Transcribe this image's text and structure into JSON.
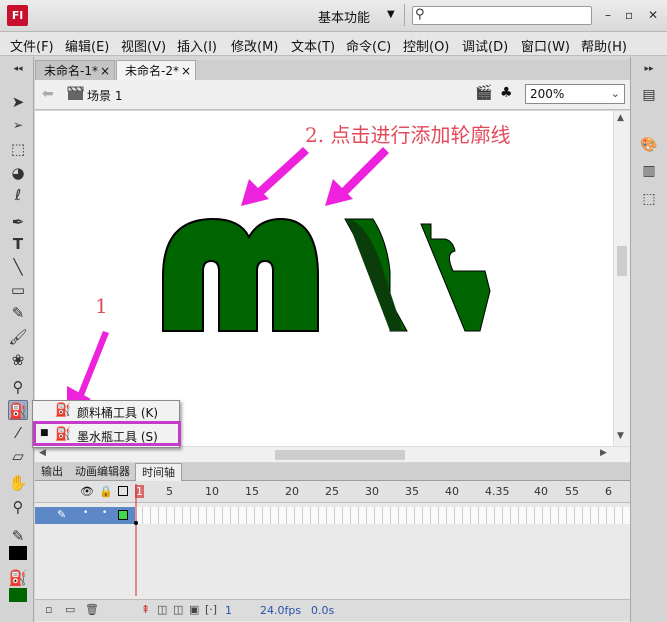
{
  "app": {
    "logo": "Fl",
    "workspace": "基本功能",
    "search_placeholder": ""
  },
  "window_controls": [
    "–",
    "▫",
    "✕"
  ],
  "menu": [
    "文件(F)",
    "编辑(E)",
    "视图(V)",
    "插入(I)",
    "修改(M)",
    "文本(T)",
    "命令(C)",
    "控制(O)",
    "调试(D)",
    "窗口(W)",
    "帮助(H)"
  ],
  "tabs": [
    {
      "label": "未命名-1*",
      "close": "×"
    },
    {
      "label": "未命名-2*",
      "close": "×"
    }
  ],
  "editbar": {
    "scene": "场景 1",
    "zoom": "200%"
  },
  "annotations": {
    "step2": "2. 点击进行添加轮廓线",
    "step1": "1"
  },
  "popup": {
    "items": [
      {
        "label": "颜料桶工具 (K)",
        "selected": false
      },
      {
        "label": "墨水瓶工具 (S)",
        "selected": true
      }
    ]
  },
  "timeline": {
    "tabs": [
      "输出",
      "动画编辑器",
      "时间轴"
    ],
    "frame_numbers": [
      "1",
      "5",
      "10",
      "15",
      "20",
      "25",
      "30",
      "35",
      "40",
      "4.35",
      "40",
      "55",
      "6"
    ],
    "footer": {
      "frame": "1",
      "fps": "24.0fps",
      "time": "0.0s"
    }
  },
  "colors": {
    "shape_fill": "#006400",
    "accent": "#c43cc9",
    "arrow": "#ee22dd",
    "annotation_text": "#e24b5b"
  }
}
